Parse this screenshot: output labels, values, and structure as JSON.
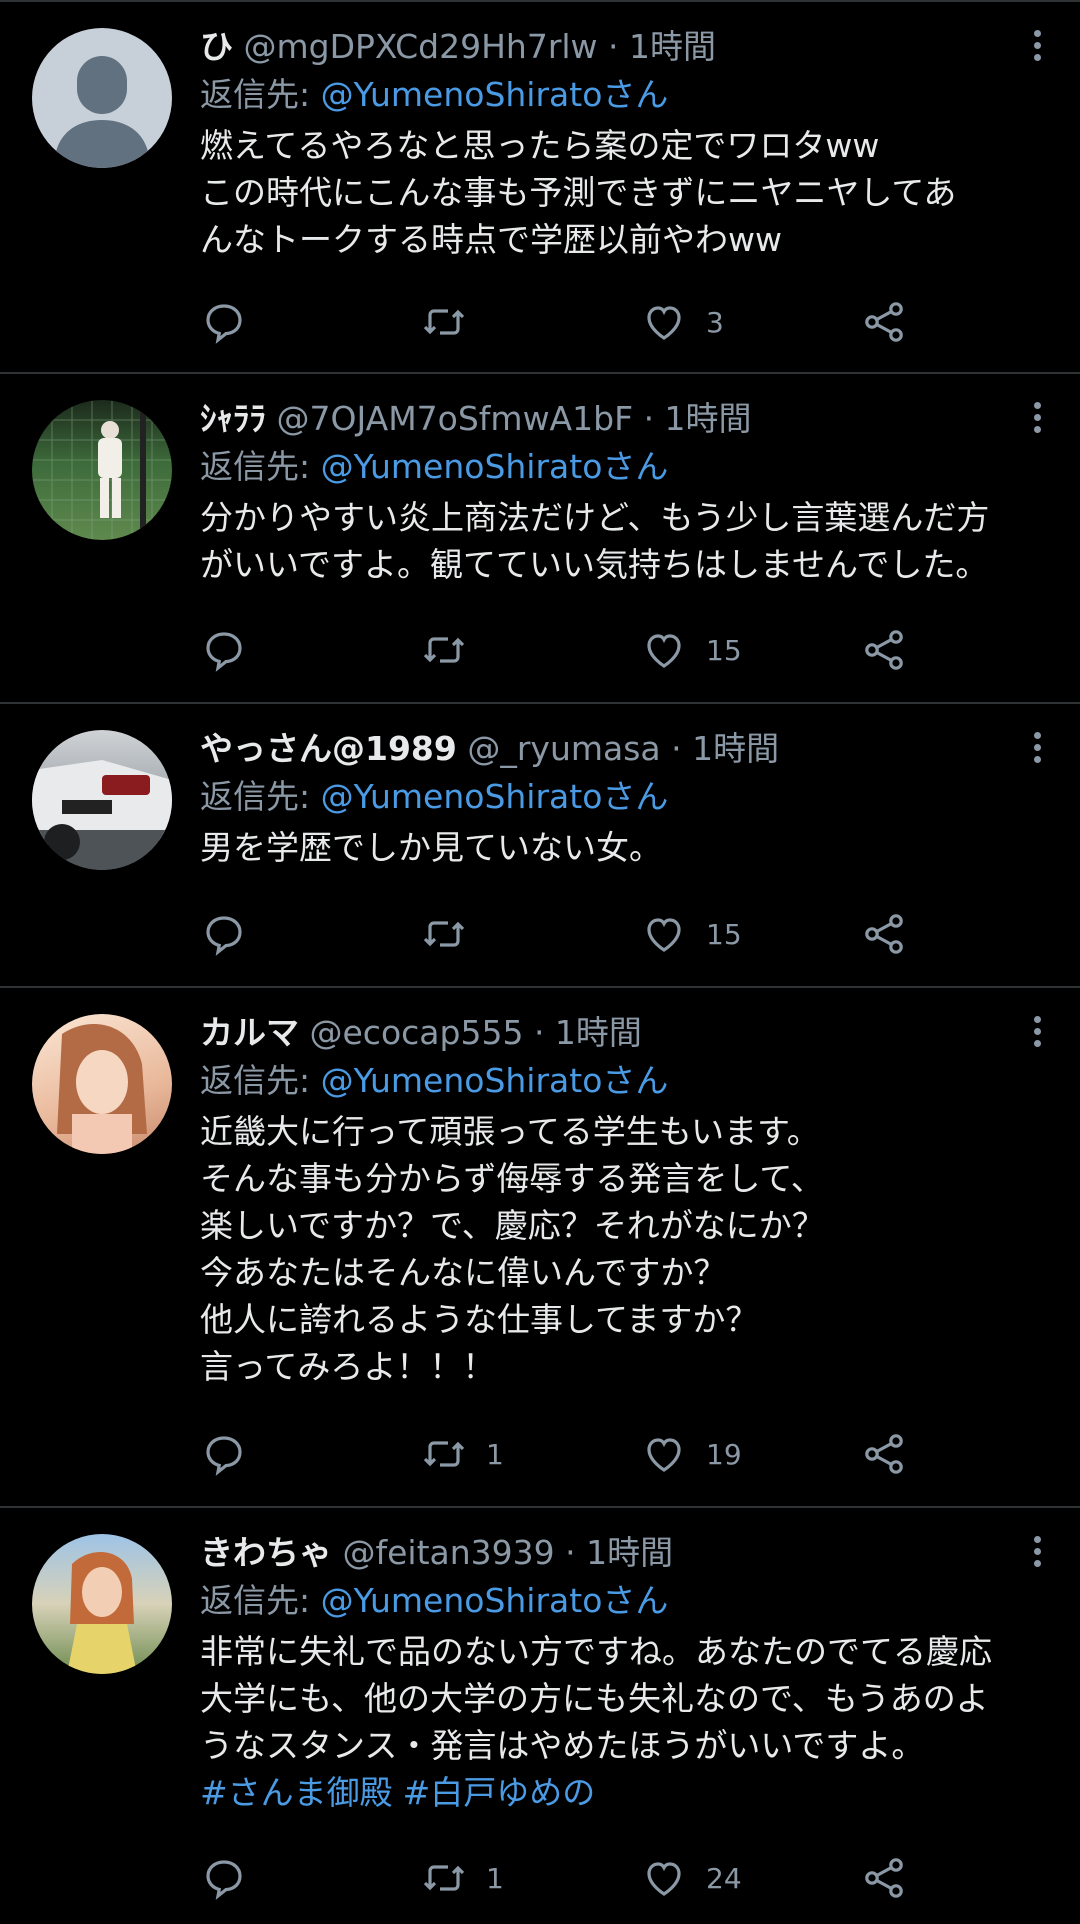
{
  "tweets": [
    {
      "name": "ひ",
      "handle": "@mgDPXCd29Hh7rlw",
      "time": "· 1時間",
      "reply_prefix": "返信先: ",
      "reply_to": "@YumenoShiratoさん",
      "text": "燃えてるやろなと思ったら案の定でワロタww\nこの時代にこんな事も予測できずにニヤニヤしてあ\nんなトークする時点で学歴以前やわww",
      "retweets": "",
      "likes": "3"
    },
    {
      "name": "ｼｬﾗﾗ",
      "handle": "@7OJAM7oSfmwA1bF",
      "time": "· 1時間",
      "reply_prefix": "返信先: ",
      "reply_to": "@YumenoShiratoさん",
      "text": "分かりやすい炎上商法だけど、もう少し言葉選んだ方\nがいいですよ。観てていい気持ちはしませんでした。",
      "retweets": "",
      "likes": "15"
    },
    {
      "name": "やっさん@1989",
      "handle": "@_ryumasa",
      "time": "· 1時間",
      "reply_prefix": "返信先: ",
      "reply_to": "@YumenoShiratoさん",
      "text": "男を学歴でしか見ていない女。",
      "retweets": "",
      "likes": "15"
    },
    {
      "name": "カルマ",
      "handle": "@ecocap555",
      "time": "· 1時間",
      "reply_prefix": "返信先: ",
      "reply_to": "@YumenoShiratoさん",
      "text": "近畿大に行って頑張ってる学生もいます。\nそんな事も分からず侮辱する発言をして、\n楽しいですか？で、慶応？それがなにか？\n今あなたはそんなに偉いんですか？\n他人に誇れるような仕事してますか？\n言ってみろよ！！！",
      "retweets": "1",
      "likes": "19"
    },
    {
      "name": "きわちゃ",
      "handle": "@feitan3939",
      "time": "· 1時間",
      "reply_prefix": "返信先: ",
      "reply_to": "@YumenoShiratoさん",
      "text": "非常に失礼で品のない方ですね。あなたのでてる慶応\n大学にも、他の大学の方にも失礼なので、もうあのよ\nうなスタンス・発言はやめたほうがいいですよ。",
      "hashtags": [
        "#さんま御殿",
        "#白戸ゆめの"
      ],
      "retweets": "1",
      "likes": "24"
    }
  ]
}
